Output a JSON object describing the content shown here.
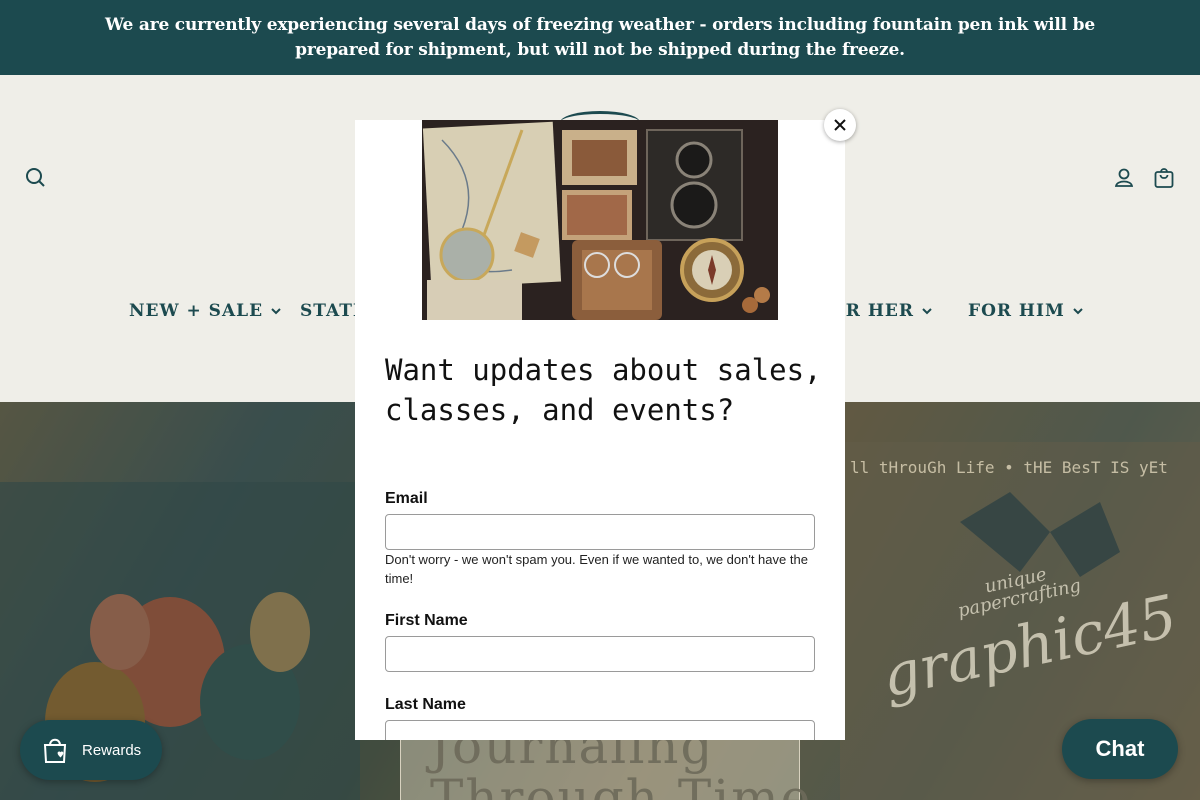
{
  "announcement": {
    "text": "We are currently experiencing several days of freezing weather - orders including fountain pen ink will be prepared for shipment, but will not be shipped during the freeze."
  },
  "header": {
    "icons": [
      "search-icon",
      "account-icon",
      "cart-icon"
    ]
  },
  "nav": {
    "items": [
      {
        "label": "NEW + SALE"
      },
      {
        "label": "STATI"
      },
      {
        "label": "OR HER"
      },
      {
        "label": "FOR HIM"
      }
    ]
  },
  "hero": {
    "ticker": "ll tHrouGh Life • tHE BesT IS yEt",
    "brand_sub": "unique\npapercrafting",
    "brand": "graphic45",
    "title": "Journaling\nThrough Time"
  },
  "modal": {
    "heading": "Want updates about sales, classes, and events?",
    "email_label": "Email",
    "email_help": "Don't worry - we won't spam you. Even if we wanted to, we don't have the time!",
    "first_name_label": "First Name",
    "last_name_label": "Last Name",
    "close_icon": "close-icon"
  },
  "rewards": {
    "label": "Rewards",
    "icon": "shopping-bag-heart-icon"
  },
  "chat": {
    "label": "Chat"
  },
  "colors": {
    "brand": "#1c4a4f",
    "header_bg": "#efeee8"
  }
}
